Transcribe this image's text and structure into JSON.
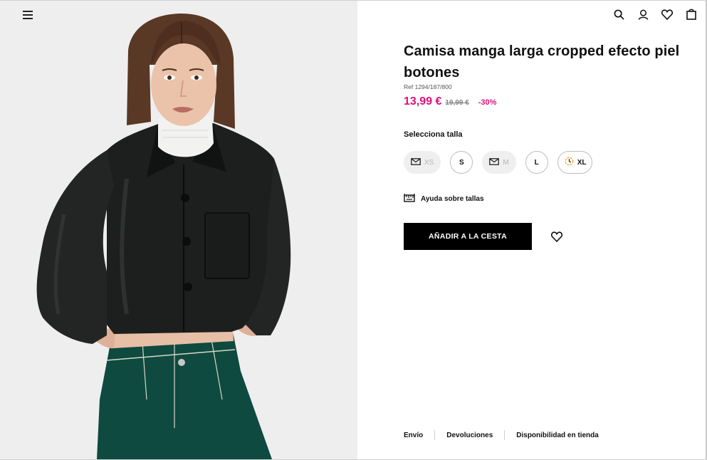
{
  "header": {
    "menu_icon": "hamburger-menu-icon",
    "icons": [
      "search-icon",
      "user-icon",
      "heart-icon",
      "bag-icon"
    ]
  },
  "product": {
    "title": "Camisa manga larga cropped efecto piel botones",
    "ref": "Ref 1294/187/800",
    "price": "13,99 €",
    "old_price": "19,99 €",
    "discount": "-30%",
    "price_color": "#e0107a",
    "image": "model-wearing-black-cropped-leather-shirt-and-green-jeans"
  },
  "sizes": {
    "label": "Selecciona talla",
    "options": [
      {
        "label": "XS",
        "status": "notify",
        "icon": "envelope-icon"
      },
      {
        "label": "S",
        "status": "available"
      },
      {
        "label": "M",
        "status": "notify",
        "icon": "envelope-icon"
      },
      {
        "label": "L",
        "status": "available"
      },
      {
        "label": "XL",
        "status": "few-left",
        "icon": "clock-icon"
      }
    ]
  },
  "size_help": {
    "label": "Ayuda sobre tallas",
    "icon": "ruler-icon"
  },
  "cart": {
    "add_label": "AÑADIR A LA CESTA"
  },
  "favorite": {
    "icon": "heart-icon"
  },
  "footer_links": [
    "Envío",
    "Devoluciones",
    "Disponibilidad en tienda"
  ]
}
